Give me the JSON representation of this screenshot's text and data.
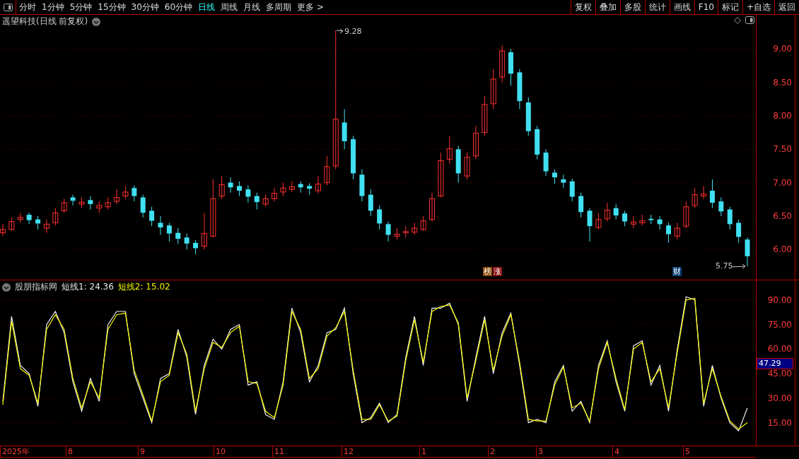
{
  "toolbar": {
    "periods": [
      {
        "label": "分时",
        "selected": false
      },
      {
        "label": "1分钟",
        "selected": false
      },
      {
        "label": "5分钟",
        "selected": false
      },
      {
        "label": "15分钟",
        "selected": false
      },
      {
        "label": "30分钟",
        "selected": false
      },
      {
        "label": "60分钟",
        "selected": false
      },
      {
        "label": "日线",
        "selected": true
      },
      {
        "label": "周线",
        "selected": false
      },
      {
        "label": "月线",
        "selected": false
      },
      {
        "label": "多周期",
        "selected": false
      },
      {
        "label": "更多 >",
        "selected": false
      }
    ],
    "buttons": [
      "复权",
      "叠加",
      "多股",
      "统计",
      "画线",
      "F10",
      "标记",
      "+自选",
      "返回"
    ]
  },
  "price_panel": {
    "title": "遥望科技(日线 前复权)",
    "high_label": "9.28",
    "low_label": "5.75",
    "markers": [
      {
        "label": "榜",
        "color": "#8a4b08"
      },
      {
        "label": "涨",
        "color": "#8b0a0a"
      },
      {
        "label": "财",
        "color": "#0d3f75"
      }
    ],
    "chart_data": {
      "type": "candlestick",
      "categories": [
        null,
        null,
        null,
        null,
        null,
        null,
        null,
        null,
        null,
        null,
        null,
        null,
        null,
        null,
        null,
        null,
        null,
        null,
        null,
        null,
        null,
        null,
        null,
        null,
        null,
        null,
        null,
        null,
        null,
        null,
        null,
        null,
        null,
        null,
        null,
        null,
        null,
        null,
        null,
        null,
        null,
        null,
        null,
        null,
        null,
        null,
        null,
        null,
        null,
        null,
        null,
        null,
        null,
        null,
        null,
        null,
        null,
        null,
        null,
        null,
        null,
        null,
        null,
        null,
        null,
        null,
        null,
        null,
        null,
        null,
        null,
        null,
        null,
        null,
        null,
        null,
        null,
        null,
        null,
        null,
        null,
        null,
        null,
        null,
        null,
        null
      ],
      "ohlc": [
        [
          6.25,
          6.38,
          6.2,
          6.3
        ],
        [
          6.3,
          6.48,
          6.28,
          6.42
        ],
        [
          6.45,
          6.55,
          6.4,
          6.48
        ],
        [
          6.52,
          6.55,
          6.38,
          6.44
        ],
        [
          6.45,
          6.5,
          6.3,
          6.39
        ],
        [
          6.32,
          6.45,
          6.25,
          6.38
        ],
        [
          6.4,
          6.62,
          6.36,
          6.55
        ],
        [
          6.58,
          6.76,
          6.55,
          6.7
        ],
        [
          6.78,
          6.82,
          6.66,
          6.73
        ],
        [
          6.68,
          6.78,
          6.62,
          6.71
        ],
        [
          6.74,
          6.8,
          6.6,
          6.68
        ],
        [
          6.62,
          6.72,
          6.55,
          6.66
        ],
        [
          6.64,
          6.78,
          6.6,
          6.7
        ],
        [
          6.72,
          6.9,
          6.68,
          6.78
        ],
        [
          6.8,
          6.95,
          6.75,
          6.86
        ],
        [
          6.92,
          6.96,
          6.72,
          6.8
        ],
        [
          6.78,
          6.82,
          6.48,
          6.55
        ],
        [
          6.58,
          6.64,
          6.35,
          6.43
        ],
        [
          6.4,
          6.5,
          6.22,
          6.33
        ],
        [
          6.36,
          6.4,
          6.12,
          6.24
        ],
        [
          6.25,
          6.32,
          6.08,
          6.16
        ],
        [
          6.18,
          6.24,
          6.0,
          6.09
        ],
        [
          6.1,
          6.14,
          5.93,
          6.02
        ],
        [
          6.05,
          6.55,
          6.0,
          6.24
        ],
        [
          6.2,
          7.05,
          6.18,
          6.76
        ],
        [
          6.8,
          7.1,
          6.75,
          6.97
        ],
        [
          7.0,
          7.08,
          6.85,
          6.93
        ],
        [
          6.95,
          7.02,
          6.8,
          6.88
        ],
        [
          6.9,
          6.96,
          6.7,
          6.79
        ],
        [
          6.8,
          6.85,
          6.6,
          6.71
        ],
        [
          6.68,
          6.82,
          6.64,
          6.76
        ],
        [
          6.76,
          6.92,
          6.72,
          6.84
        ],
        [
          6.86,
          7.0,
          6.8,
          6.92
        ],
        [
          6.9,
          7.02,
          6.86,
          6.94
        ],
        [
          6.98,
          7.02,
          6.85,
          6.93
        ],
        [
          6.95,
          6.99,
          6.82,
          6.91
        ],
        [
          6.88,
          7.1,
          6.84,
          6.98
        ],
        [
          7.0,
          7.4,
          6.96,
          7.24
        ],
        [
          7.25,
          9.28,
          7.2,
          7.95
        ],
        [
          7.9,
          8.1,
          7.5,
          7.62
        ],
        [
          7.65,
          7.7,
          7.05,
          7.14
        ],
        [
          7.12,
          7.2,
          6.72,
          6.8
        ],
        [
          6.82,
          6.9,
          6.5,
          6.58
        ],
        [
          6.6,
          6.66,
          6.3,
          6.39
        ],
        [
          6.38,
          6.42,
          6.12,
          6.22
        ],
        [
          6.2,
          6.32,
          6.15,
          6.23
        ],
        [
          6.25,
          6.35,
          6.18,
          6.27
        ],
        [
          6.26,
          6.4,
          6.22,
          6.32
        ],
        [
          6.3,
          6.5,
          6.28,
          6.43
        ],
        [
          6.45,
          6.85,
          6.42,
          6.76
        ],
        [
          6.8,
          7.45,
          6.78,
          7.33
        ],
        [
          7.35,
          7.7,
          7.28,
          7.51
        ],
        [
          7.5,
          7.55,
          7.0,
          7.14
        ],
        [
          7.1,
          7.45,
          7.05,
          7.38
        ],
        [
          7.4,
          7.85,
          7.35,
          7.74
        ],
        [
          7.75,
          8.3,
          7.7,
          8.17
        ],
        [
          8.18,
          8.7,
          8.1,
          8.55
        ],
        [
          8.58,
          9.05,
          8.5,
          8.97
        ],
        [
          8.95,
          9.0,
          8.45,
          8.63
        ],
        [
          8.65,
          8.7,
          8.1,
          8.22
        ],
        [
          8.2,
          8.28,
          7.7,
          7.77
        ],
        [
          7.8,
          7.85,
          7.35,
          7.42
        ],
        [
          7.45,
          7.5,
          7.1,
          7.17
        ],
        [
          7.15,
          7.2,
          6.98,
          7.08
        ],
        [
          7.05,
          7.12,
          6.92,
          7.0
        ],
        [
          7.02,
          7.06,
          6.72,
          6.79
        ],
        [
          6.8,
          6.85,
          6.48,
          6.56
        ],
        [
          6.58,
          6.62,
          6.12,
          6.35
        ],
        [
          6.33,
          6.55,
          6.3,
          6.45
        ],
        [
          6.46,
          6.7,
          6.42,
          6.59
        ],
        [
          6.62,
          6.68,
          6.45,
          6.51
        ],
        [
          6.54,
          6.58,
          6.35,
          6.42
        ],
        [
          6.38,
          6.5,
          6.32,
          6.41
        ],
        [
          6.4,
          6.52,
          6.36,
          6.43
        ],
        [
          6.46,
          6.52,
          6.38,
          6.44
        ],
        [
          6.45,
          6.5,
          6.3,
          6.38
        ],
        [
          6.36,
          6.4,
          6.1,
          6.23
        ],
        [
          6.2,
          6.4,
          6.15,
          6.32
        ],
        [
          6.35,
          6.72,
          6.32,
          6.64
        ],
        [
          6.66,
          6.92,
          6.62,
          6.82
        ],
        [
          6.8,
          6.95,
          6.75,
          6.83
        ],
        [
          6.88,
          7.05,
          6.62,
          6.7
        ],
        [
          6.72,
          6.78,
          6.5,
          6.57
        ],
        [
          6.6,
          6.64,
          6.3,
          6.38
        ],
        [
          6.4,
          6.45,
          6.1,
          6.19
        ],
        [
          6.15,
          6.18,
          5.75,
          5.9
        ]
      ],
      "ylim": [
        5.55,
        9.51
      ],
      "yticks": [
        {
          "value": 9,
          "label": "9.00"
        },
        {
          "value": 8.5,
          "label": "8.50"
        },
        {
          "value": 8,
          "label": "8.00"
        },
        {
          "value": 7.5,
          "label": "7.50"
        },
        {
          "value": 7,
          "label": "7.00"
        },
        {
          "value": 6.5,
          "label": "6.50"
        },
        {
          "value": 6,
          "label": "6.00"
        }
      ],
      "grid": true
    }
  },
  "indicator_panel": {
    "title": "股朋指标网",
    "legend": [
      {
        "text": "短线1: 24.36",
        "color": "#e8e8e8"
      },
      {
        "text": "短线2: 15.02",
        "color": "#f5f500"
      }
    ],
    "current_value": "47.29",
    "chart_data": {
      "type": "line",
      "categories": [
        null,
        null,
        null,
        null,
        null,
        null,
        null,
        null,
        null,
        null,
        null,
        null,
        null,
        null,
        null,
        null,
        null,
        null,
        null,
        null,
        null,
        null,
        null,
        null,
        null,
        null,
        null,
        null,
        null,
        null,
        null,
        null,
        null,
        null,
        null,
        null,
        null,
        null,
        null,
        null,
        null,
        null,
        null,
        null,
        null,
        null,
        null,
        null,
        null,
        null,
        null,
        null,
        null,
        null,
        null,
        null,
        null,
        null,
        null,
        null,
        null,
        null,
        null,
        null,
        null,
        null,
        null,
        null,
        null,
        null,
        null,
        null,
        null,
        null,
        null,
        null,
        null,
        null,
        null,
        null,
        null,
        null,
        null,
        null,
        null,
        null
      ],
      "series": [
        {
          "color": "#f0f0f0",
          "values": [
            28,
            80,
            50,
            45,
            25,
            75,
            83,
            70,
            40,
            22,
            42,
            28,
            75,
            83,
            83,
            45,
            30,
            15,
            42,
            45,
            72,
            55,
            20,
            50,
            66,
            60,
            72,
            75,
            38,
            40,
            20,
            17,
            40,
            85,
            70,
            40,
            50,
            70,
            72,
            85,
            45,
            15,
            18,
            27,
            15,
            20,
            55,
            80,
            50,
            85,
            85,
            88,
            75,
            28,
            55,
            80,
            45,
            70,
            82,
            50,
            15,
            17,
            15,
            40,
            50,
            22,
            28,
            15,
            50,
            65,
            40,
            22,
            62,
            65,
            38,
            50,
            22,
            60,
            92,
            90,
            25,
            50,
            30,
            15,
            10,
            24
          ]
        },
        {
          "color": "#f5f500",
          "values": [
            26,
            77,
            48,
            44,
            27,
            72,
            81,
            72,
            42,
            24,
            40,
            30,
            72,
            81,
            82,
            47,
            32,
            16,
            40,
            44,
            70,
            57,
            22,
            48,
            64,
            61,
            70,
            74,
            40,
            39,
            22,
            18,
            38,
            83,
            72,
            42,
            48,
            68,
            73,
            83,
            47,
            17,
            17,
            26,
            16,
            19,
            53,
            78,
            52,
            83,
            86,
            87,
            76,
            30,
            53,
            78,
            47,
            68,
            81,
            52,
            17,
            16,
            16,
            38,
            49,
            24,
            27,
            16,
            48,
            64,
            42,
            23,
            60,
            64,
            40,
            48,
            24,
            58,
            90,
            91,
            27,
            48,
            31,
            16,
            11,
            15
          ]
        }
      ],
      "ylim": [
        1,
        102
      ],
      "yticks": [
        {
          "value": 90,
          "label": "90.00"
        },
        {
          "value": 75,
          "label": "75.00"
        },
        {
          "value": 60,
          "label": "60.00"
        },
        {
          "value": 45,
          "label": "45.00"
        },
        {
          "value": 30,
          "label": "30.00"
        },
        {
          "value": 15,
          "label": "15.00"
        }
      ],
      "grid": true
    }
  },
  "time_axis": [
    "2025年",
    "8",
    "9",
    "10",
    "11",
    "12",
    "1",
    "2",
    "3",
    "4",
    "5"
  ]
}
